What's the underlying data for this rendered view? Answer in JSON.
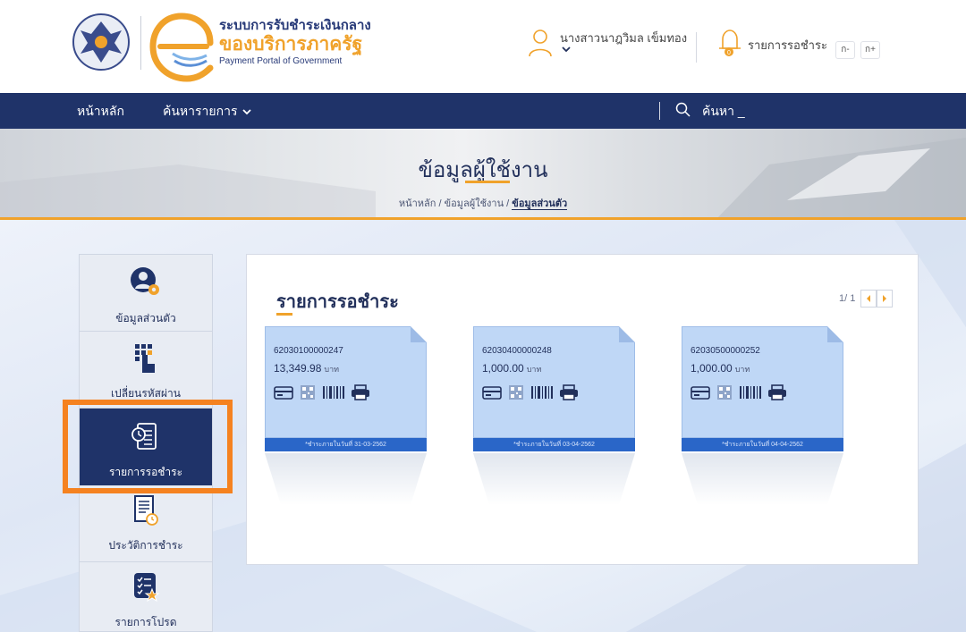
{
  "header": {
    "brand_line1": "ระบบการรับชำระเงินกลาง",
    "brand_line2": "ของบริการภาครัฐ",
    "brand_line3": "Payment Portal of Government",
    "user_name": "นางสาวนาฎวิมล เข็มทอง",
    "notify_label": "รายการรอชำระ",
    "font_decrease": "ก-",
    "font_increase": "ก+"
  },
  "nav": {
    "home": "หน้าหลัก",
    "search_items": "ค้นหารายการ",
    "search_placeholder": "ค้นหา _"
  },
  "hero": {
    "title": "ข้อมูลผู้ใช้งาน",
    "breadcrumb": [
      "หน้าหลัก",
      "ข้อมูลผู้ใช้งาน",
      "ข้อมูลส่วนตัว"
    ]
  },
  "sidebar": {
    "items": [
      {
        "label": "ข้อมูลส่วนตัว",
        "icon": "user-gear-icon"
      },
      {
        "label": "เปลี่ยนรหัสผ่าน",
        "icon": "keypad-icon"
      },
      {
        "label": "รายการรอชำระ",
        "icon": "clock-document-icon",
        "active": true
      },
      {
        "label": "ประวัติการชำระ",
        "icon": "history-document-icon"
      },
      {
        "label": "รายการโปรด",
        "icon": "favorite-list-icon"
      }
    ]
  },
  "panel": {
    "title": "รายการรอชำระ",
    "pager": "1/ 1"
  },
  "cards": [
    {
      "ref": "62030100000247",
      "amount": "13,349.98",
      "unit": "บาท",
      "due": "*ชำระภายในวันที่ 31-03-2562"
    },
    {
      "ref": "62030400000248",
      "amount": "1,000.00",
      "unit": "บาท",
      "due": "*ชำระภายในวันที่ 03-04-2562"
    },
    {
      "ref": "62030500000252",
      "amount": "1,000.00",
      "unit": "บาท",
      "due": "*ชำระภายในวันที่ 04-04-2562"
    }
  ],
  "colors": {
    "navy": "#1f3369",
    "accent": "#f0a22b",
    "highlight": "#f58220",
    "card_face": "#bfd7f6",
    "card_band": "#2a66c8"
  }
}
